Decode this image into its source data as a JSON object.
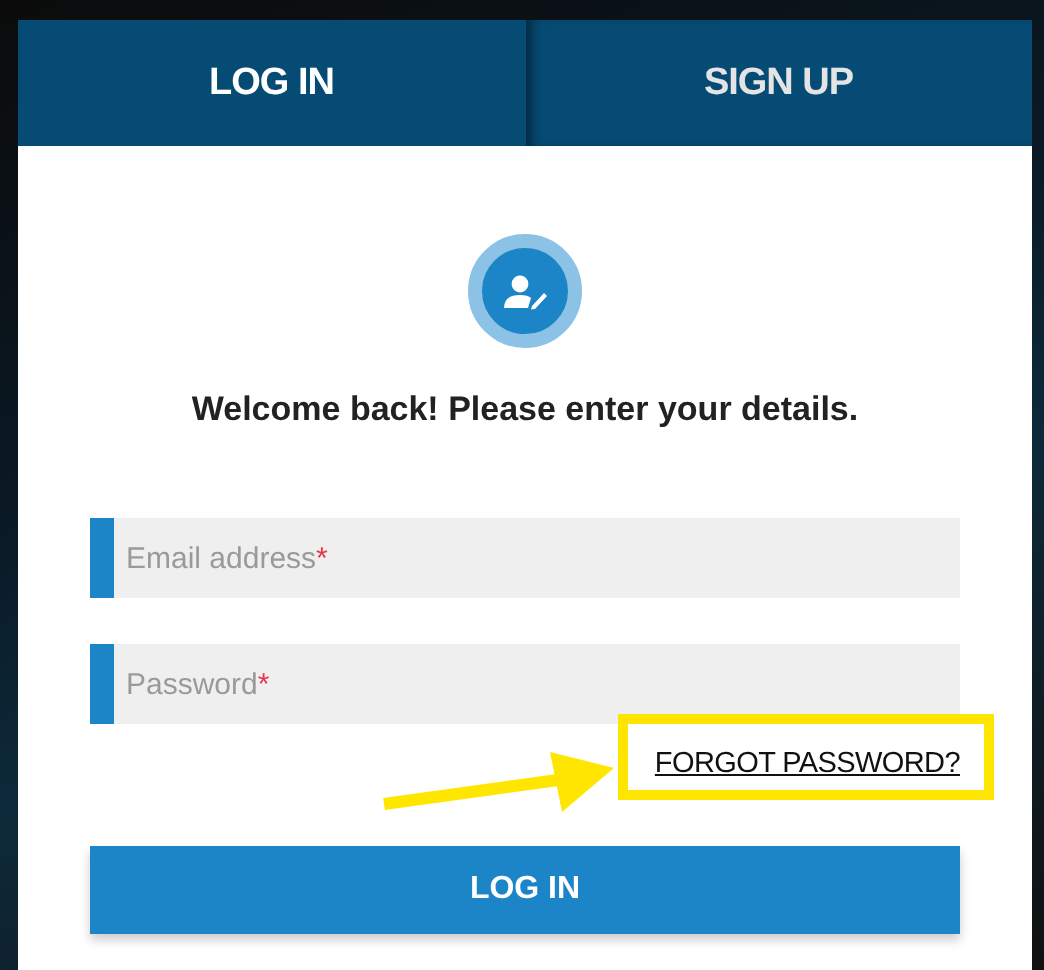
{
  "tabs": [
    {
      "label": "LOG IN",
      "selected": true
    },
    {
      "label": "SIGN UP",
      "selected": false
    }
  ],
  "heading": "Welcome back! Please enter your details.",
  "fields": [
    {
      "placeholder": "Email address",
      "required_mark": "*"
    },
    {
      "placeholder": "Password",
      "required_mark": "*"
    }
  ],
  "forgot_link": "FORGOT PASSWORD?",
  "submit_button": "LOG IN",
  "highlight_box": true,
  "pointer_arrow": true
}
